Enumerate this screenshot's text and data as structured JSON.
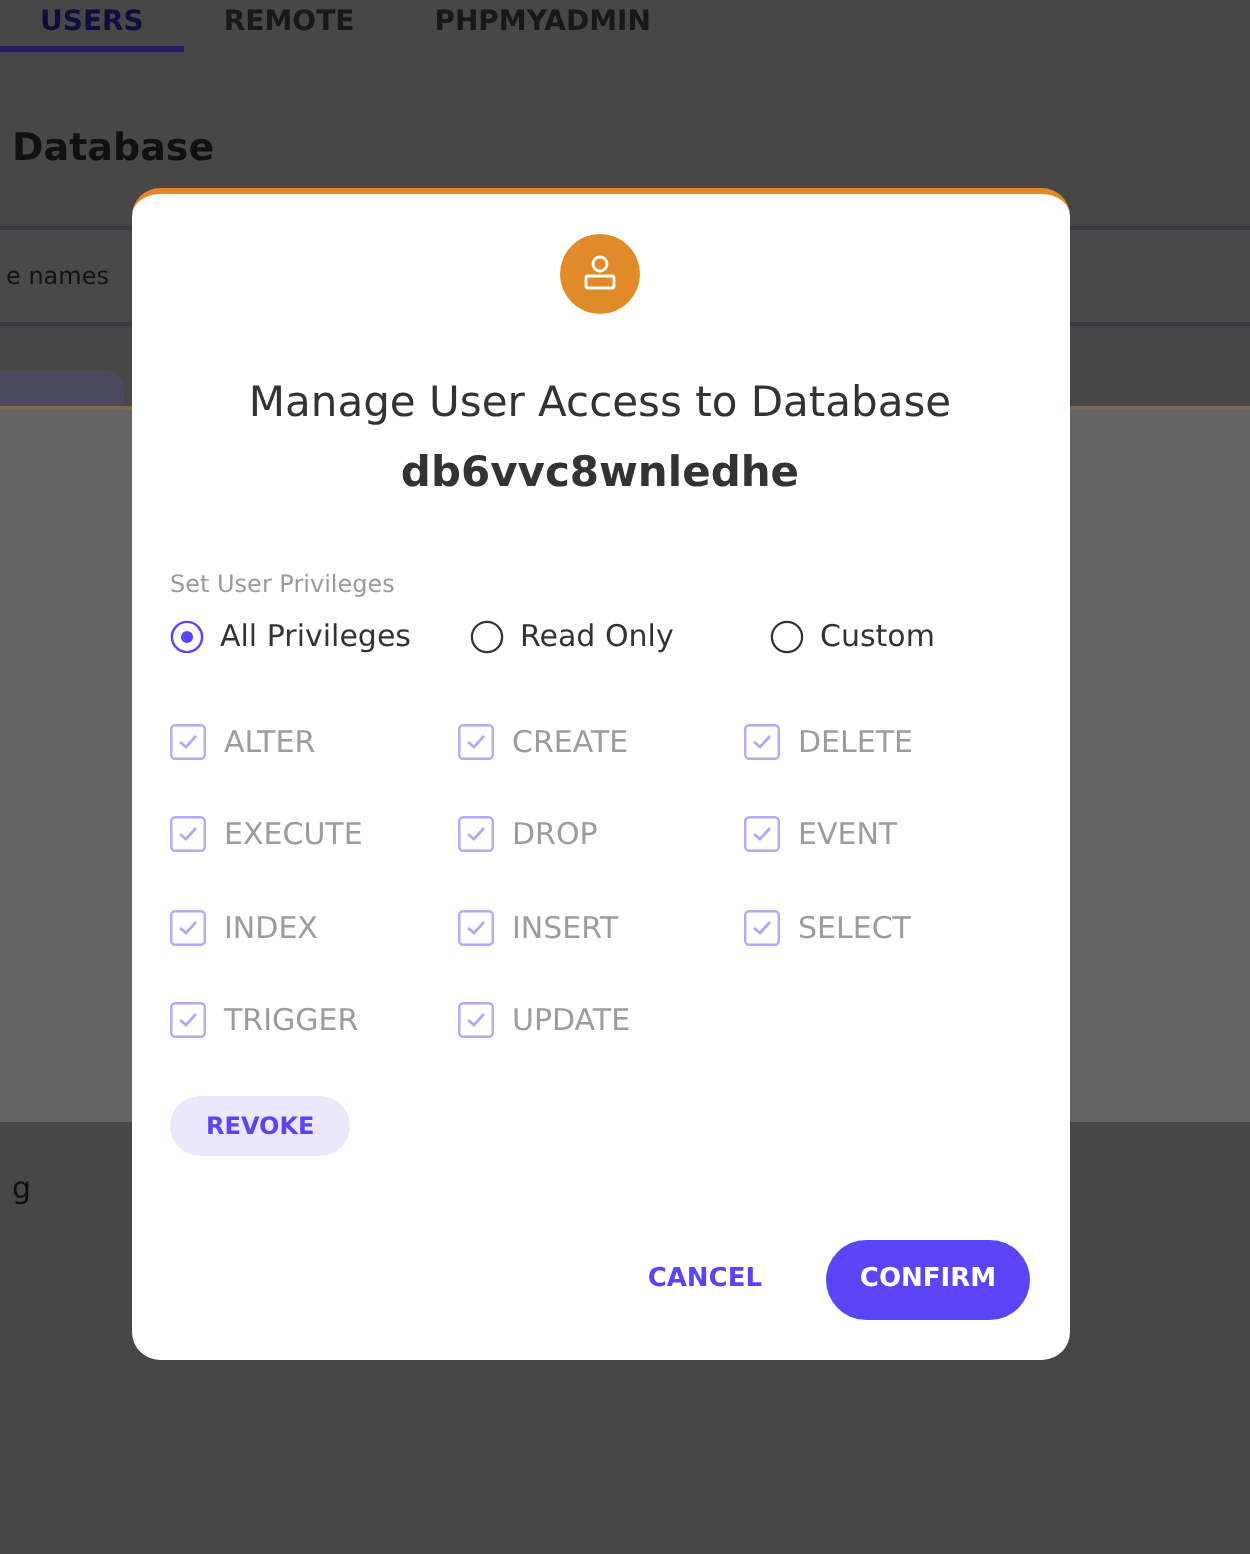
{
  "background": {
    "tabs": [
      {
        "label": "USERS",
        "selected": true
      },
      {
        "label": "REMOTE",
        "selected": false
      },
      {
        "label": "PHPMYADMIN",
        "selected": false
      }
    ],
    "heading": "Database",
    "search": {
      "placeholder": "e names"
    },
    "footer_text": "g"
  },
  "dialog": {
    "title": "Manage User Access to Database",
    "database": "db6vvc8wnledhe",
    "privileges_label": "Set User Privileges",
    "modes": [
      {
        "label": "All Privileges",
        "selected": true
      },
      {
        "label": "Read Only",
        "selected": false
      },
      {
        "label": "Custom",
        "selected": false
      }
    ],
    "privileges": [
      {
        "label": "ALTER",
        "checked": true,
        "disabled": true
      },
      {
        "label": "CREATE",
        "checked": true,
        "disabled": true
      },
      {
        "label": "DELETE",
        "checked": true,
        "disabled": true
      },
      {
        "label": "EXECUTE",
        "checked": true,
        "disabled": true
      },
      {
        "label": "DROP",
        "checked": true,
        "disabled": true
      },
      {
        "label": "EVENT",
        "checked": true,
        "disabled": true
      },
      {
        "label": "INDEX",
        "checked": true,
        "disabled": true
      },
      {
        "label": "INSERT",
        "checked": true,
        "disabled": true
      },
      {
        "label": "SELECT",
        "checked": true,
        "disabled": true
      },
      {
        "label": "TRIGGER",
        "checked": true,
        "disabled": true
      },
      {
        "label": "UPDATE",
        "checked": true,
        "disabled": true
      }
    ],
    "revoke_button": "REVOKE",
    "buttons": [
      {
        "label": "CANCEL",
        "kind": "text"
      },
      {
        "label": "CONFIRM",
        "kind": "primary"
      }
    ]
  }
}
